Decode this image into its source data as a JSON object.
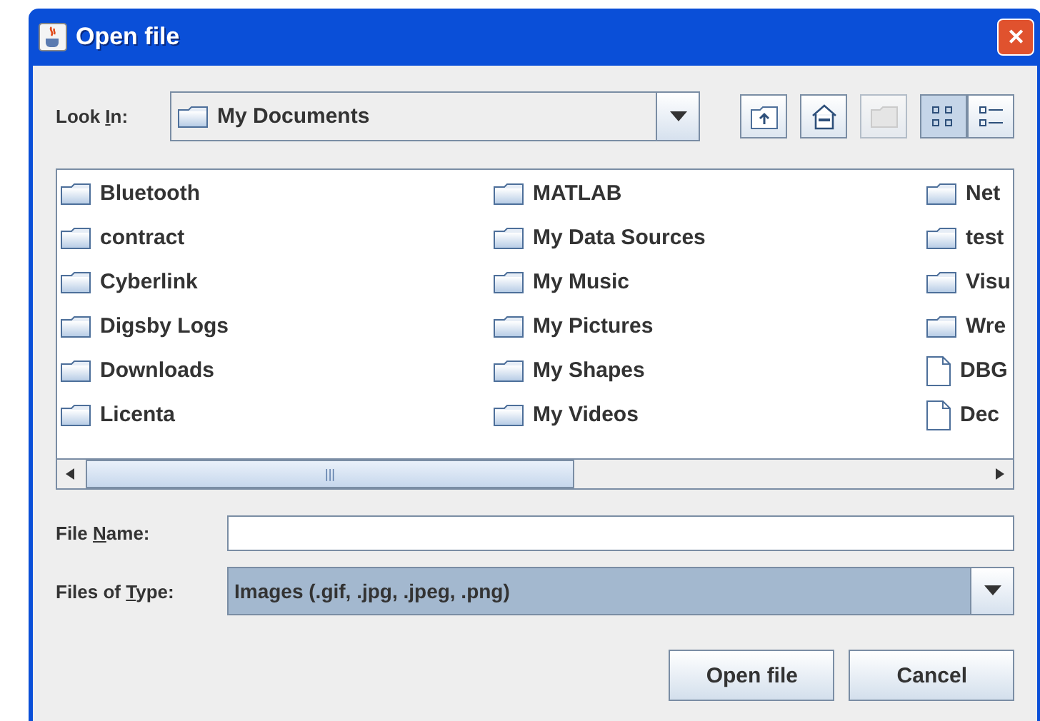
{
  "window": {
    "title": "Open file",
    "close": "✕"
  },
  "look_in": {
    "label": {
      "before": "Look ",
      "key": "I",
      "after": "n:"
    },
    "value": "My Documents"
  },
  "toolbar": [
    {
      "kind": "up",
      "disabled": false,
      "selected": false
    },
    {
      "kind": "home",
      "disabled": false,
      "selected": false
    },
    {
      "kind": "new-folder",
      "disabled": true,
      "selected": false
    },
    {
      "kind": "list",
      "disabled": false,
      "selected": true
    },
    {
      "kind": "details",
      "disabled": false,
      "selected": false
    }
  ],
  "files": [
    {
      "name": "Bluetooth",
      "kind": "folder"
    },
    {
      "name": "contract",
      "kind": "folder"
    },
    {
      "name": "Cyberlink",
      "kind": "folder"
    },
    {
      "name": "Digsby Logs",
      "kind": "folder"
    },
    {
      "name": "Downloads",
      "kind": "folder"
    },
    {
      "name": "Licenta",
      "kind": "folder"
    },
    {
      "name": "MATLAB",
      "kind": "folder"
    },
    {
      "name": "My Data Sources",
      "kind": "folder"
    },
    {
      "name": "My Music",
      "kind": "folder"
    },
    {
      "name": "My Pictures",
      "kind": "folder"
    },
    {
      "name": "My Shapes",
      "kind": "folder"
    },
    {
      "name": "My Videos",
      "kind": "folder"
    },
    {
      "name": "Net",
      "kind": "folder"
    },
    {
      "name": "test",
      "kind": "folder"
    },
    {
      "name": "Visu",
      "kind": "folder"
    },
    {
      "name": "Wre",
      "kind": "folder"
    },
    {
      "name": "DBG",
      "kind": "file"
    },
    {
      "name": "Dec",
      "kind": "file"
    }
  ],
  "scroll_grip": "|||",
  "file_name": {
    "label": {
      "before": "File ",
      "key": "N",
      "after": "ame:"
    }
  },
  "file_type": {
    "label": {
      "before": "Files of ",
      "key": "T",
      "after": "ype:"
    },
    "value": "Images (.gif, .jpg, .jpeg, .png)"
  },
  "buttons": [
    "Open file",
    "Cancel"
  ]
}
